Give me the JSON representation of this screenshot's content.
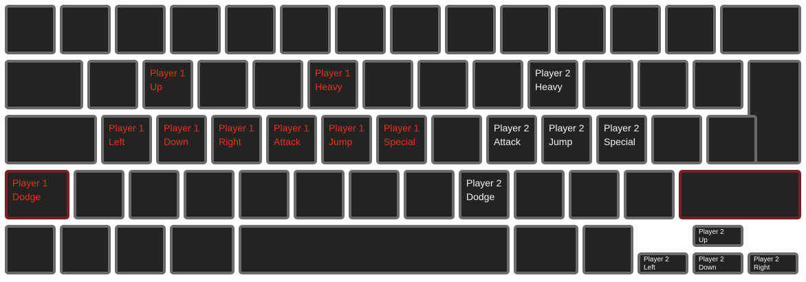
{
  "colors": {
    "key_face": "#232323",
    "key_border": "#6a6a6a",
    "player1": "#e8321e",
    "player2": "#f2f2f2",
    "highlight_border": "#7a2020"
  },
  "keys": {
    "q": {
      "l1": "Player 1",
      "l2": "Up"
    },
    "r": {
      "l1": "Player 1",
      "l2": "Heavy"
    },
    "o": {
      "l1": "Player 2",
      "l2": "Heavy"
    },
    "a": {
      "l1": "Player 1",
      "l2": "Left"
    },
    "s": {
      "l1": "Player 1",
      "l2": "Down"
    },
    "d": {
      "l1": "Player 1",
      "l2": "Right"
    },
    "f": {
      "l1": "Player 1",
      "l2": "Attack"
    },
    "g": {
      "l1": "Player 1",
      "l2": "Jump"
    },
    "h": {
      "l1": "Player 1",
      "l2": "Special"
    },
    "k": {
      "l1": "Player 2",
      "l2": "Attack"
    },
    "l": {
      "l1": "Player 2",
      "l2": "Jump"
    },
    "semicolon": {
      "l1": "Player 2",
      "l2": "Special"
    },
    "lshift": {
      "l1": "Player 1",
      "l2": "Dodge"
    },
    "m": {
      "l1": "Player 2",
      "l2": "Dodge"
    },
    "arrow_up": {
      "l1": "Player 2",
      "l2": "Up"
    },
    "arrow_left": {
      "l1": "Player 2",
      "l2": "Left"
    },
    "arrow_down": {
      "l1": "Player 2",
      "l2": "Down"
    },
    "arrow_right": {
      "l1": "Player 2",
      "l2": "Right"
    }
  }
}
